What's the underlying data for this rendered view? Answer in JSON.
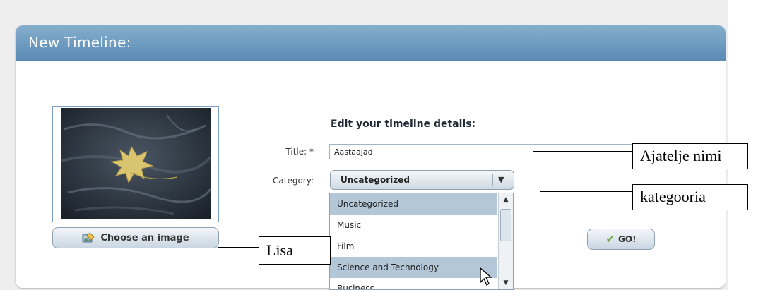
{
  "panel": {
    "title": "New Timeline:"
  },
  "image": {
    "choose_label": "Choose an image"
  },
  "form": {
    "heading": "Edit your timeline details:",
    "title_label": "Title: *",
    "title_value": "Aastaajad",
    "category_label": "Category:",
    "category_value": "Uncategorized",
    "category_options": [
      "Uncategorized",
      "Music",
      "Film",
      "Science and Technology",
      "Business"
    ],
    "go_label": "GO!"
  },
  "annotations": {
    "title_note": "Ajatelje nimi",
    "category_note": "kategooria",
    "image_note": "Lisa"
  },
  "colors": {
    "header": "#5a8ab4",
    "highlight": "#b4c7d8",
    "go_check": "#6fa83a"
  }
}
